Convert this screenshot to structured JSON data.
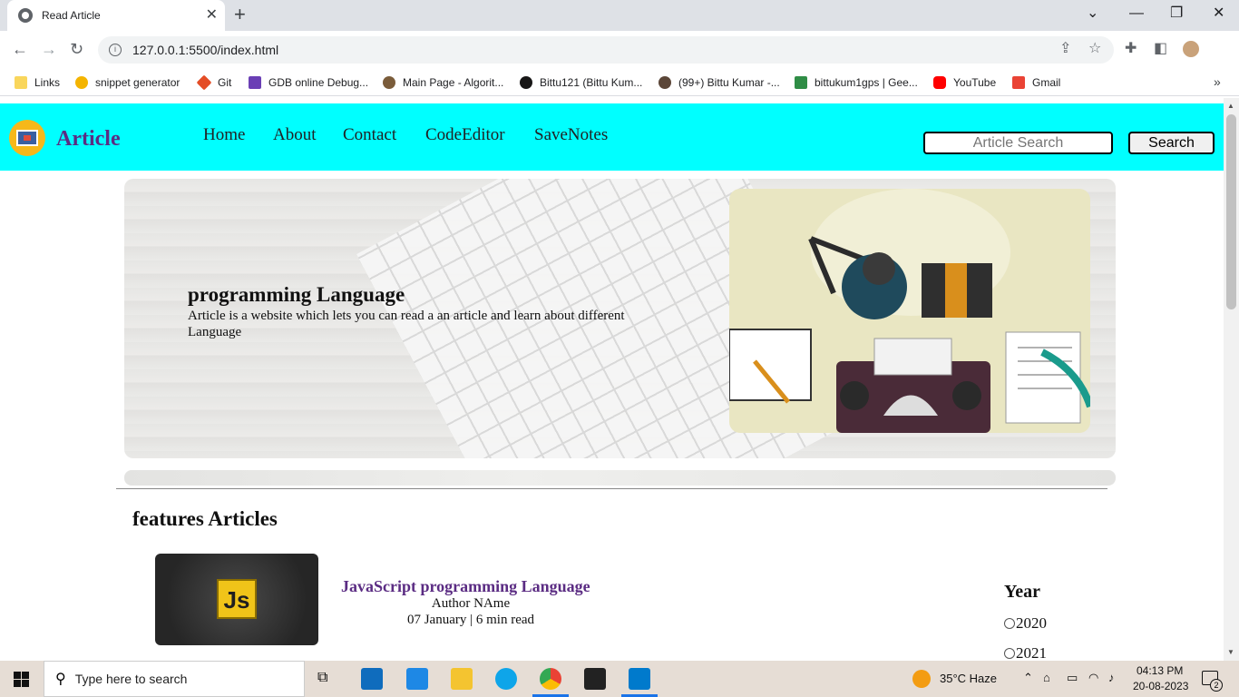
{
  "browser": {
    "tab_title": "Read Article",
    "url": "127.0.0.1:5500/index.html",
    "bookmarks": [
      {
        "label": "Links",
        "icon": "folder-icon",
        "color": "#f9d65c"
      },
      {
        "label": "snippet generator",
        "icon": "star-icon",
        "color": "#f4b400"
      },
      {
        "label": "Git",
        "icon": "git-icon",
        "color": "#e44d26"
      },
      {
        "label": "GDB online Debug...",
        "icon": "gdb-icon",
        "color": "#6a3fb5"
      },
      {
        "label": "Main Page - Algorit...",
        "icon": "algorithm-icon",
        "color": "#7a5c3a"
      },
      {
        "label": "Bittu121 (Bittu Kum...",
        "icon": "github-icon",
        "color": "#181717"
      },
      {
        "label": "(99+) Bittu Kumar -...",
        "icon": "codechef-icon",
        "color": "#5b4638"
      },
      {
        "label": "bittukum1gps | Gee...",
        "icon": "geeksforgeeks-icon",
        "color": "#2f8d46"
      },
      {
        "label": "YouTube",
        "icon": "youtube-icon",
        "color": "#ff0000"
      },
      {
        "label": "Gmail",
        "icon": "gmail-icon",
        "color": "#ea4335"
      }
    ]
  },
  "site": {
    "brand": "Article",
    "nav": [
      "Home",
      "About",
      "Contact",
      "CodeEditor",
      "SaveNotes"
    ],
    "search_placeholder": "Article Search",
    "search_button": "Search",
    "accent": "#00ffff",
    "brand_color": "#5b2c83"
  },
  "hero": {
    "title": "programming Language",
    "text": "Article is a website which lets you can read a an article and learn about different Language"
  },
  "features": {
    "title": "features Articles",
    "card": {
      "title": "JavaScript programming Language",
      "author": "Author NAme",
      "meta": "07 January | 6 min read",
      "thumb_label": "Js"
    }
  },
  "filter": {
    "title": "Year",
    "options": [
      "2020",
      "2021"
    ]
  },
  "taskbar": {
    "search_placeholder": "Type here to search",
    "weather": "35°C  Haze",
    "time": "04:13 PM",
    "date": "20-08-2023",
    "notifications": "2"
  }
}
